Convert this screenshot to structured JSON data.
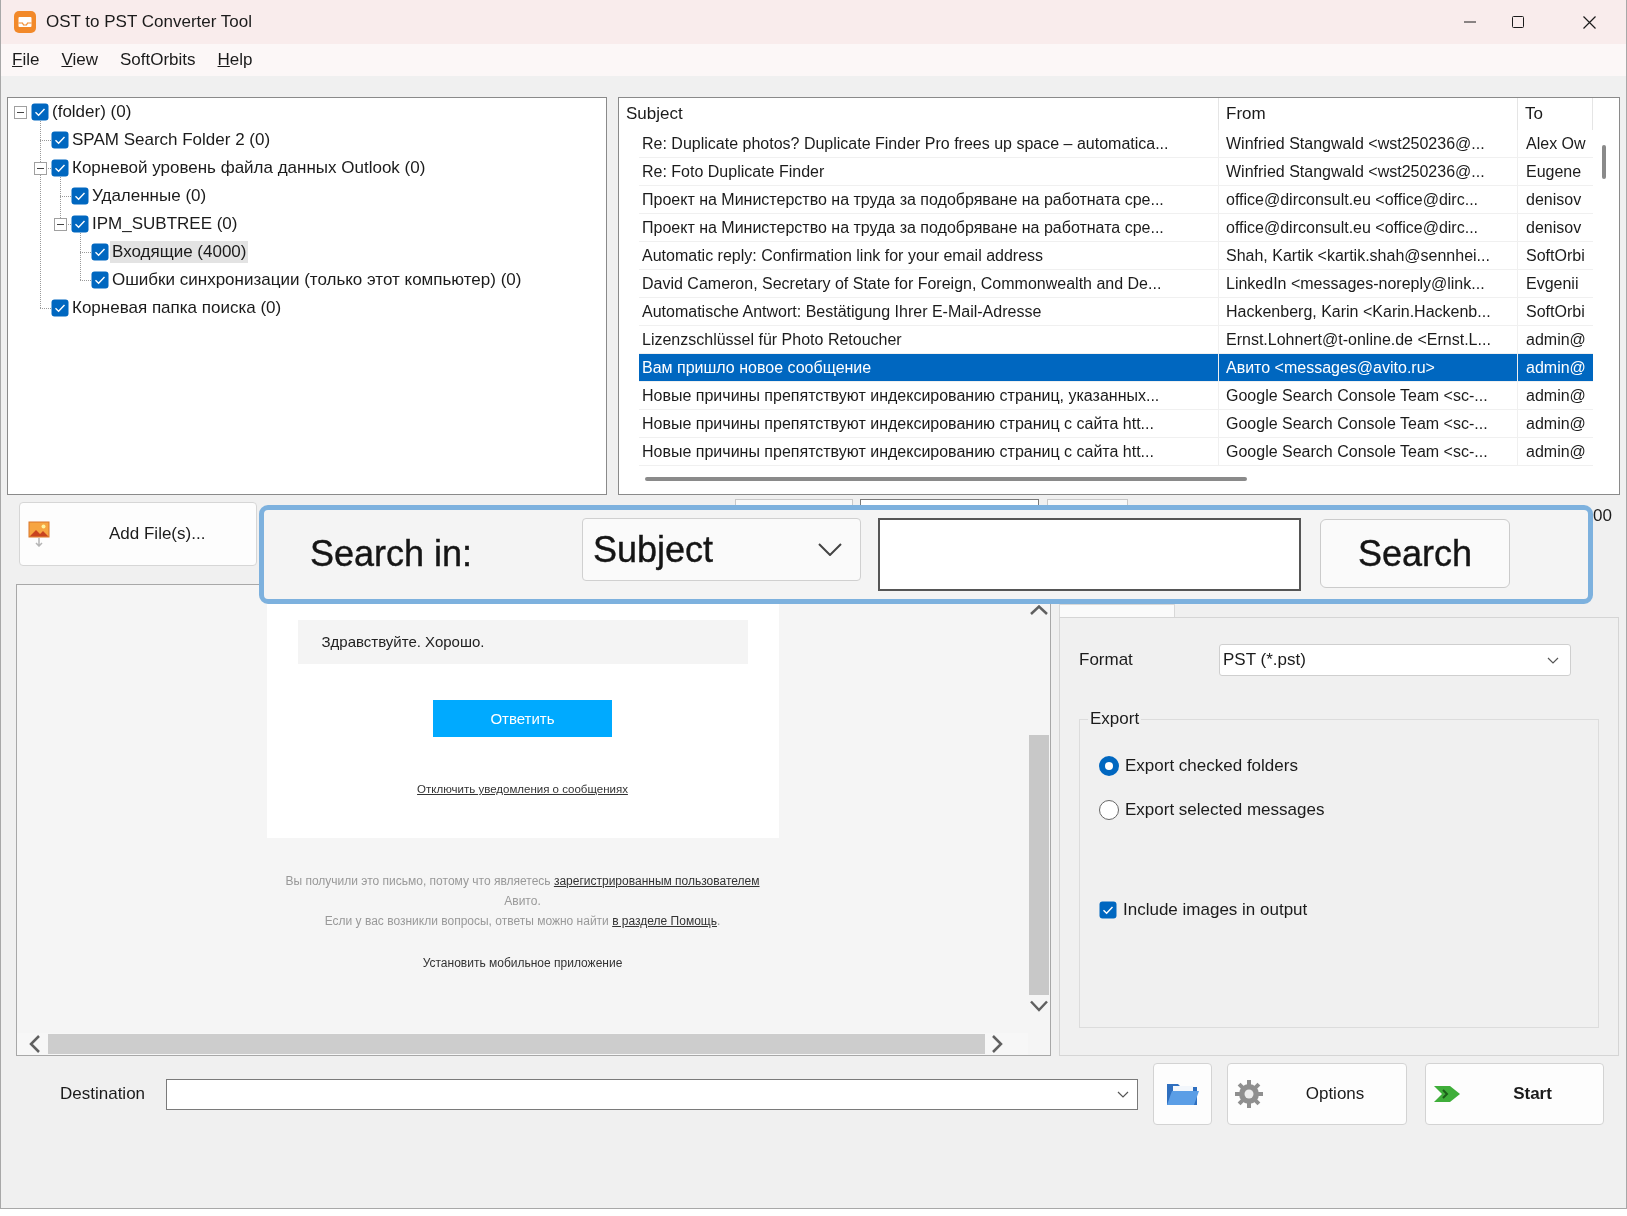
{
  "window": {
    "title": "OST to PST Converter Tool"
  },
  "menu": [
    {
      "label": "File",
      "underlined_key": true
    },
    {
      "label": "View",
      "underlined_key": true
    },
    {
      "label": "SoftOrbits",
      "underlined_key": false
    },
    {
      "label": "Help",
      "underlined_key": true
    }
  ],
  "folder_tree": [
    {
      "label": "(folder) (0)",
      "checked": true,
      "selected": false,
      "expanded": true,
      "children": [
        {
          "label": "SPAM Search Folder 2 (0)",
          "checked": true,
          "selected": false
        },
        {
          "label": "Корневой уровень файла данных Outlook (0)",
          "checked": true,
          "selected": false,
          "expanded": true,
          "children": [
            {
              "label": "Удаленные (0)",
              "checked": true,
              "selected": false
            },
            {
              "label": "IPM_SUBTREE (0)",
              "checked": true,
              "selected": false,
              "expanded": true,
              "children": [
                {
                  "label": "Входящие (4000)",
                  "checked": true,
                  "selected": true
                },
                {
                  "label": "Ошибки синхронизации (только этот компьютер) (0)",
                  "checked": true,
                  "selected": false
                }
              ]
            }
          ]
        },
        {
          "label": "Корневая папка поиска (0)",
          "checked": true,
          "selected": false
        }
      ]
    }
  ],
  "message_list": {
    "columns": [
      "Subject",
      "From",
      "To"
    ],
    "rows": [
      {
        "subject": "Re: Duplicate photos? Duplicate Finder Pro frees up space – automatica...",
        "from": "Winfried Stangwald <wst250236@...",
        "to": "Alex Ow",
        "selected": false
      },
      {
        "subject": "Re: Foto Duplicate Finder",
        "from": "Winfried Stangwald <wst250236@...",
        "to": "Eugene",
        "selected": false
      },
      {
        "subject": "Проект на Министерство на труда за подобряване на работната сре...",
        "from": "office@dirconsult.eu <office@dirc...",
        "to": "denisov",
        "selected": false
      },
      {
        "subject": "Проект на Министерство на труда за подобряване на работната сре...",
        "from": "office@dirconsult.eu <office@dirc...",
        "to": "denisov",
        "selected": false
      },
      {
        "subject": "Automatic reply: Confirmation link for your email address",
        "from": "Shah, Kartik <kartik.shah@sennhei...",
        "to": "SoftOrbi",
        "selected": false
      },
      {
        "subject": "David Cameron, Secretary of State for Foreign, Commonwealth and De...",
        "from": "LinkedIn <messages-noreply@link...",
        "to": "Evgenii",
        "selected": false
      },
      {
        "subject": "Automatische Antwort: Bestätigung Ihrer E-Mail-Adresse",
        "from": "Hackenberg, Karin <Karin.Hackenb...",
        "to": "SoftOrbi",
        "selected": false
      },
      {
        "subject": "Lizenzschlüssel für Photo Retoucher",
        "from": "Ernst.Lohnert@t-online.de <Ernst.L...",
        "to": "admin@",
        "selected": false
      },
      {
        "subject": "Вам пришло новое сообщение",
        "from": "Авито <messages@avito.ru>",
        "to": "admin@",
        "selected": true
      },
      {
        "subject": "Новые причины препятствуют индексированию страниц, указанных...",
        "from": "Google Search Console Team <sc-...",
        "to": "admin@",
        "selected": false
      },
      {
        "subject": "Новые причины препятствуют индексированию страниц с сайта htt...",
        "from": "Google Search Console Team <sc-...",
        "to": "admin@",
        "selected": false
      },
      {
        "subject": "Новые причины препятствуют индексированию страниц с сайта htt...",
        "from": "Google Search Console Team <sc-...",
        "to": "admin@",
        "selected": false
      }
    ]
  },
  "add_files_button": {
    "label": "Add File(s)..."
  },
  "text_fragment": "00",
  "search_bar": {
    "label": "Search in:",
    "field": "Subject",
    "button": "Search"
  },
  "preview": {
    "quote": "Здравствуйте. Хорошо.",
    "reply_button": "Ответить",
    "unsubscribe_link": "Отключить уведомления о сообщениях",
    "footer_notes": [
      [
        {
          "kind": "text",
          "text": "Вы получили это письмо, потому что являетесь "
        },
        {
          "kind": "link",
          "text": "зарегистрированным пользователем"
        },
        {
          "kind": "text",
          "text": " Авито."
        }
      ],
      [
        {
          "kind": "text",
          "text": "Если у вас возникли вопросы, ответы можно найти "
        },
        {
          "kind": "link",
          "text": "в разделе Помощь"
        },
        {
          "kind": "text",
          "text": "."
        }
      ]
    ],
    "app_link": "Установить мобильное приложение"
  },
  "export_settings": {
    "format_label": "Format",
    "format": "PST (*.pst)",
    "group_label": "Export",
    "scope_options": [
      {
        "label": "Export checked folders",
        "selected": true
      },
      {
        "label": "Export selected messages",
        "selected": false
      }
    ],
    "include_images": {
      "label": "Include images in output",
      "checked": true
    }
  },
  "destination": {
    "label": "Destination"
  },
  "actions": [
    {
      "kind": "browse"
    },
    {
      "kind": "options",
      "label": "Options"
    },
    {
      "kind": "start",
      "label": "Start"
    }
  ]
}
